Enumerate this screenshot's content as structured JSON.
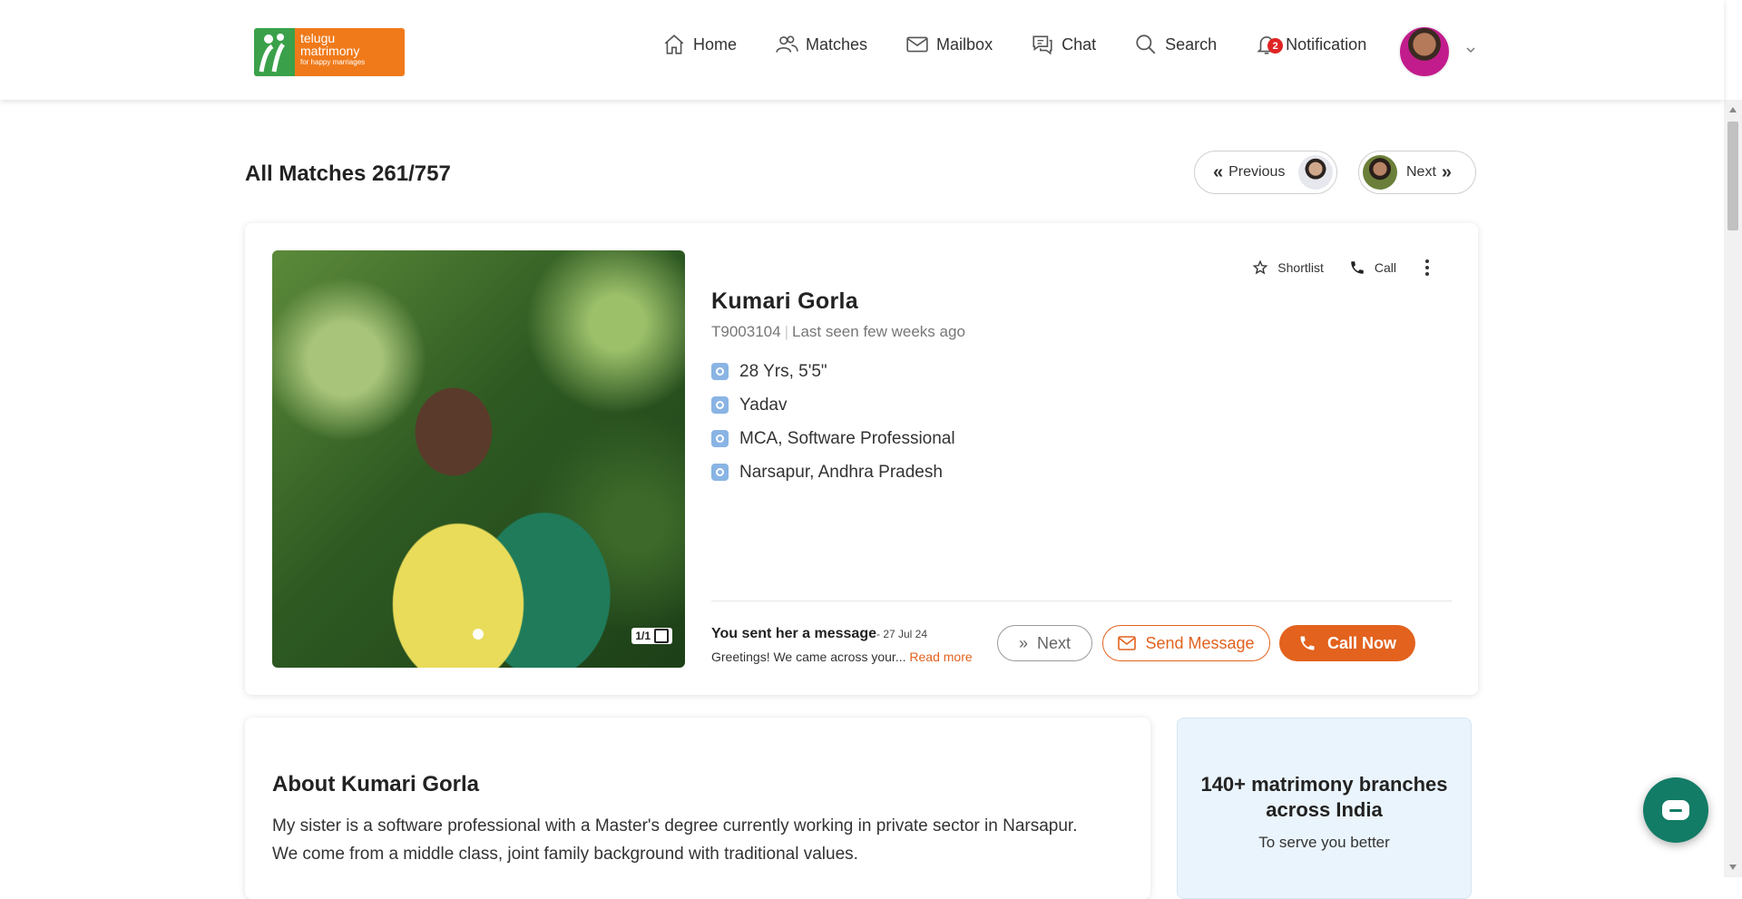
{
  "logo": {
    "line1": "telugu",
    "line2": "matrimony",
    "line3": "for happy marriages"
  },
  "nav": {
    "home": "Home",
    "matches": "Matches",
    "mailbox": "Mailbox",
    "chat": "Chat",
    "search": "Search",
    "notification": "Notification",
    "notification_count": "2"
  },
  "page": {
    "title": "All Matches 261/757",
    "previous": "Previous",
    "next": "Next"
  },
  "profile": {
    "photo_count": "1/1",
    "actions": {
      "shortlist": "Shortlist",
      "call": "Call"
    },
    "name": "Kumari Gorla",
    "id": "T9003104",
    "last_seen": "Last seen few weeks ago",
    "facts": [
      {
        "icon": "age-icon",
        "text": "28 Yrs, 5'5\""
      },
      {
        "icon": "caste-icon",
        "text": "Yadav"
      },
      {
        "icon": "education-icon",
        "text": "MCA, Software Professional"
      },
      {
        "icon": "location-pin-icon",
        "text": "Narsapur, Andhra Pradesh"
      }
    ],
    "message": {
      "title": "You sent her a message",
      "date": "- 27 Jul 24",
      "preview": "Greetings! We came across your...",
      "read_more": "Read more"
    },
    "buttons": {
      "next": "Next",
      "send_message": "Send Message",
      "call_now": "Call Now"
    }
  },
  "about": {
    "title": "About Kumari Gorla",
    "text": "My sister is a software professional with a Master's degree currently working in private sector in Narsapur. We come from a middle class, joint family background with traditional values."
  },
  "branches": {
    "title": "140+ matrimony branches across India",
    "subtitle": "To serve you better"
  },
  "colors": {
    "accent": "#e2621e",
    "brand_green": "#3aa14a",
    "brand_orange": "#f07a1a",
    "chat_fab": "#127c66"
  }
}
